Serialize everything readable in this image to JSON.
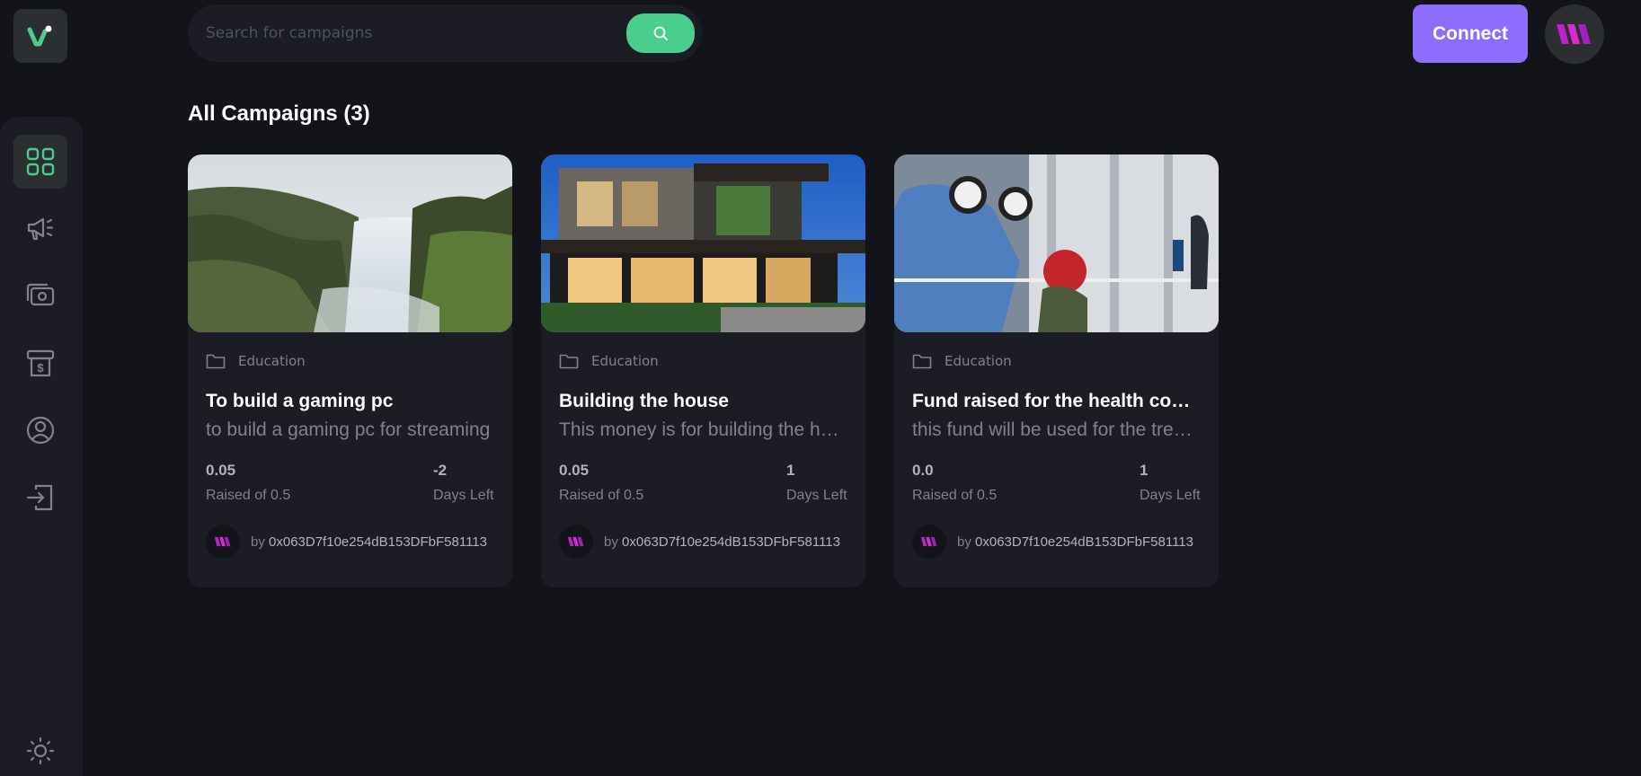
{
  "search": {
    "placeholder": "Search for campaigns"
  },
  "header": {
    "connect_label": "Connect"
  },
  "main": {
    "title": "All Campaigns (3)"
  },
  "sidebar": {
    "items": [
      {
        "name": "dashboard",
        "icon": "dashboard-grid-icon",
        "active": true
      },
      {
        "name": "campaign",
        "icon": "megaphone-icon",
        "active": false
      },
      {
        "name": "payment",
        "icon": "payment-icon",
        "active": false
      },
      {
        "name": "withdraw",
        "icon": "withdraw-icon",
        "active": false
      },
      {
        "name": "profile",
        "icon": "profile-icon",
        "active": false
      },
      {
        "name": "logout",
        "icon": "logout-icon",
        "active": false
      }
    ],
    "theme_icon": "sun-icon"
  },
  "campaigns": [
    {
      "category": "Education",
      "title": "To build a gaming pc",
      "description": "to build a gaming pc for streaming",
      "raised": "0.05",
      "raised_label": "Raised of 0.5",
      "days": "-2",
      "days_label": "Days Left",
      "owner_prefix": "by",
      "owner": "0x063D7f10e254dB153DFbF581113"
    },
    {
      "category": "Education",
      "title": "Building the house",
      "description": "This money is for building the house",
      "raised": "0.05",
      "raised_label": "Raised of 0.5",
      "days": "1",
      "days_label": "Days Left",
      "owner_prefix": "by",
      "owner": "0x063D7f10e254dB153DFbF581113"
    },
    {
      "category": "Education",
      "title": "Fund raised for the health concern",
      "description": "this fund will be used for the treatment",
      "raised": "0.0",
      "raised_label": "Raised of 0.5",
      "days": "1",
      "days_label": "Days Left",
      "owner_prefix": "by",
      "owner": "0x063D7f10e254dB153DFbF581113"
    }
  ],
  "colors": {
    "background": "#13131a",
    "panel": "#1c1c24",
    "accent_green": "#4acd8d",
    "accent_purple": "#8c6dfd",
    "text_muted": "#808191"
  }
}
